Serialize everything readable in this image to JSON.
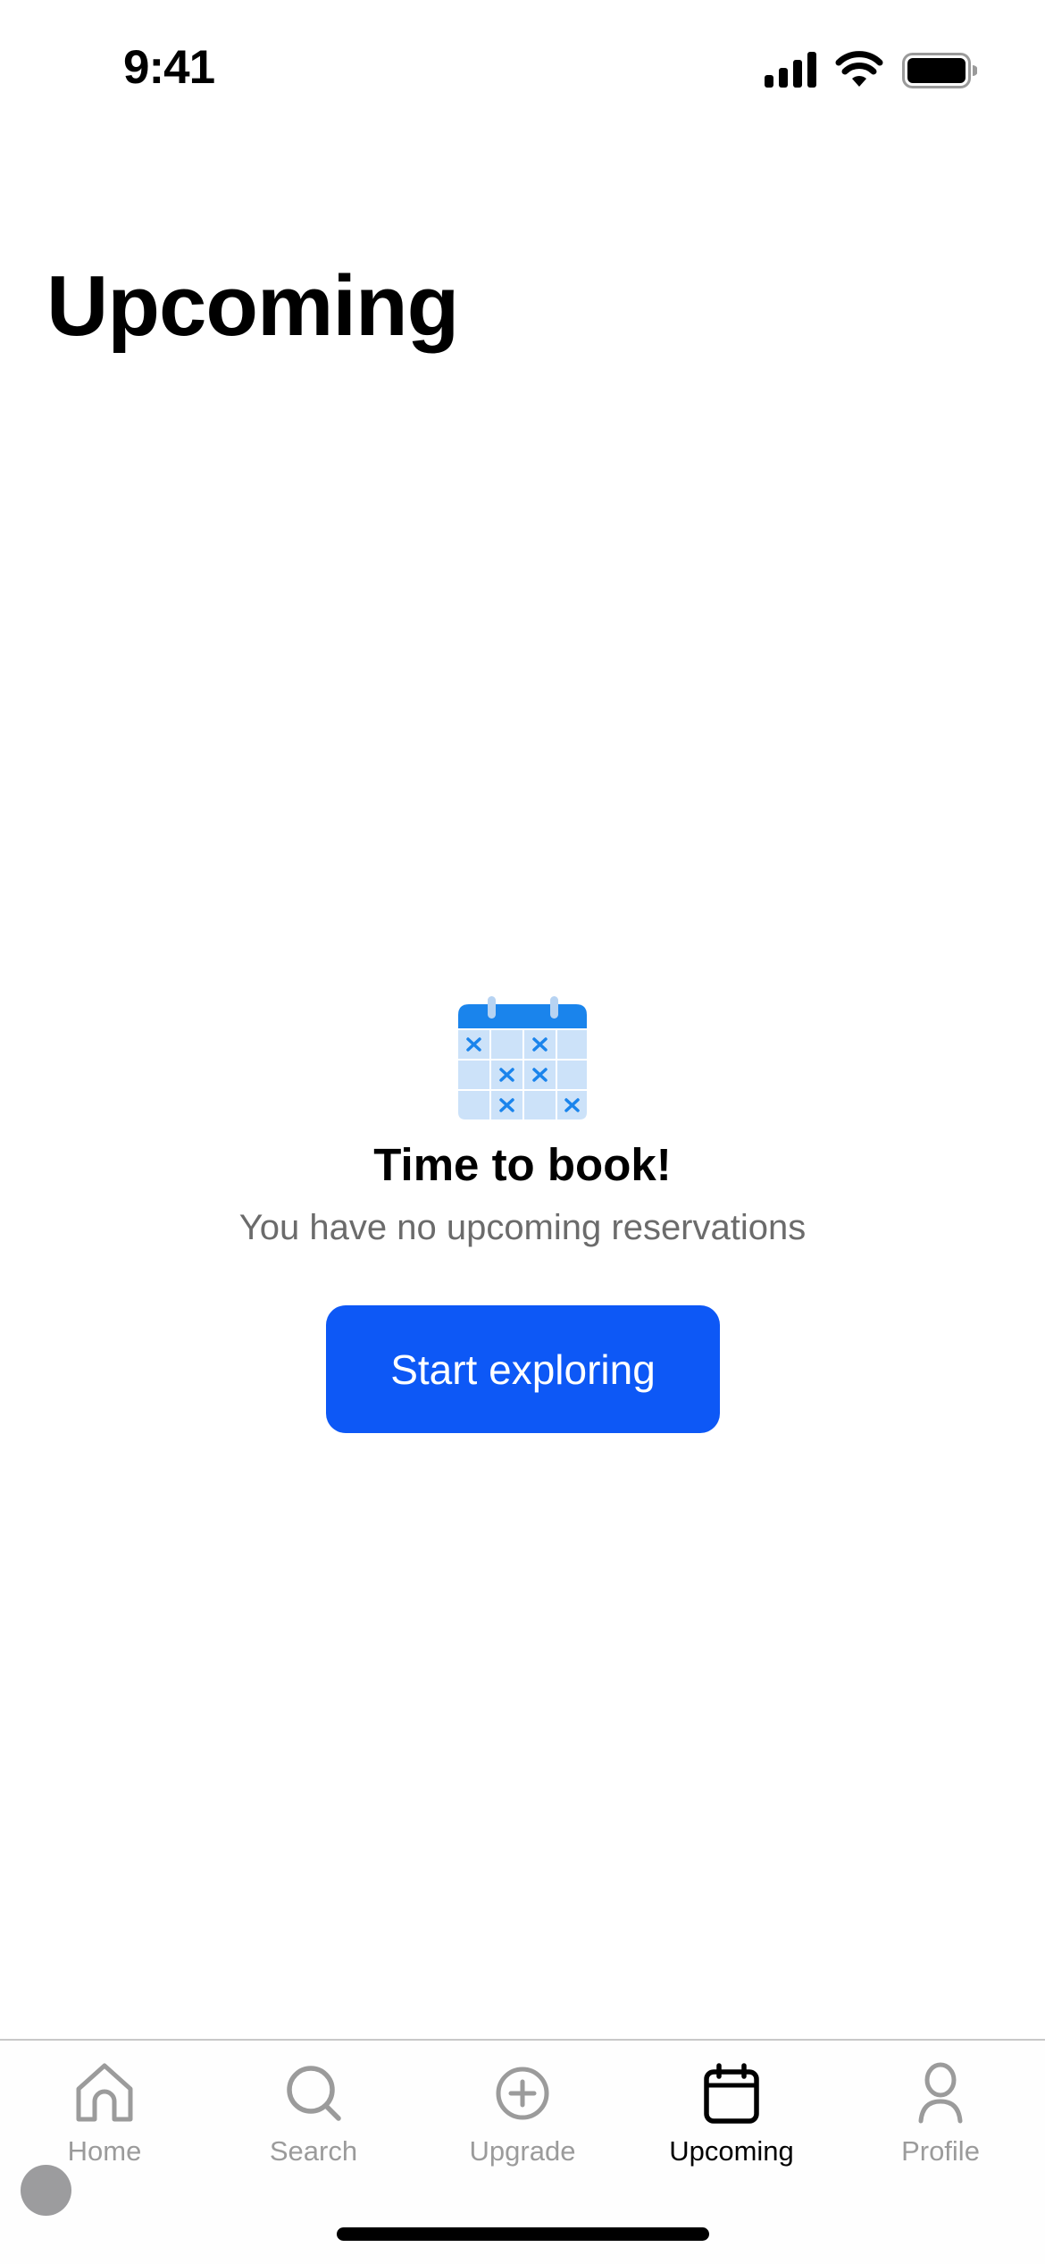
{
  "status_bar": {
    "time": "9:41",
    "icons": [
      "cellular-signal-icon",
      "wifi-icon",
      "battery-icon"
    ]
  },
  "header": {
    "title": "Upcoming"
  },
  "empty_state": {
    "illustration": "calendar-with-x-marks-icon",
    "title": "Time to book!",
    "subtitle": "You have no upcoming reservations",
    "button_label": "Start exploring"
  },
  "tab_bar": {
    "active_tab": "Upcoming",
    "tabs": [
      {
        "label": "Home",
        "icon": "home-icon"
      },
      {
        "label": "Search",
        "icon": "search-icon"
      },
      {
        "label": "Upgrade",
        "icon": "plus-circle-icon"
      },
      {
        "label": "Upcoming",
        "icon": "calendar-icon"
      },
      {
        "label": "Profile",
        "icon": "person-icon"
      }
    ]
  },
  "colors": {
    "accent": "#0d58f6",
    "tab_inactive": "#9b9b9b",
    "tab_active": "#000000",
    "subtitle_text": "#6b6b6b",
    "calendar_header": "#1a84ec",
    "calendar_cell": "#cce2f9",
    "calendar_ring": "#b7d3f2"
  }
}
